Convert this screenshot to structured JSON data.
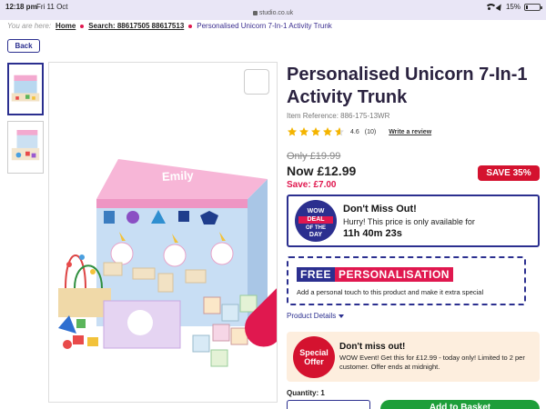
{
  "status": {
    "time": "12:18 pm",
    "date": "Fri 11 Oct",
    "url": "studio.co.uk",
    "battery": "15%",
    "battery_level": 0.15
  },
  "breadcrumb": {
    "prefix": "You are here:",
    "items": [
      "Home",
      "Search: 88617505 88617513",
      "Personalised Unicorn 7-In-1 Activity Trunk"
    ]
  },
  "back_label": "Back",
  "product": {
    "title": "Personalised Unicorn 7-In-1 Activity Trunk",
    "reference": "Item Reference: 886-175-13WR",
    "rating_value": "4.6",
    "rating_count": "(10)",
    "rating_stars": 4.6,
    "write_review": "Write a review",
    "was_price": "Only £19.99",
    "now_price": "Now £12.99",
    "save_amount": "Save: £7.00",
    "save_badge": "SAVE 35%",
    "box_name": "Emily"
  },
  "wow_deal": {
    "badge_line1": "WOW",
    "badge_line2": "DEAL",
    "badge_line3": "OF THE",
    "badge_line4": "DAY",
    "heading": "Don't Miss Out!",
    "subtext": "Hurry! This price is only available for",
    "timer": "11h 40m 23s"
  },
  "personalisation": {
    "free": "FREE",
    "personalisation": "PERSONALISATION",
    "description": "Add a personal touch to this product and make it extra special"
  },
  "details_link": "Product Details",
  "special_offer": {
    "badge_line1": "Special",
    "badge_line2": "Offer",
    "heading": "Don't miss out!",
    "text": "WOW Event! Get this for £12.99 - today only! Limited to 2 per customer. Offer ends at midnight."
  },
  "quantity": {
    "label": "Quantity: 1"
  },
  "add_to_basket": "Add to Basket",
  "colors": {
    "brand_navy": "#2b2f8f",
    "accent_pink": "#e0184f",
    "sale_red": "#d4122f",
    "star_gold": "#f4b400",
    "basket_green": "#1e9e3a"
  }
}
